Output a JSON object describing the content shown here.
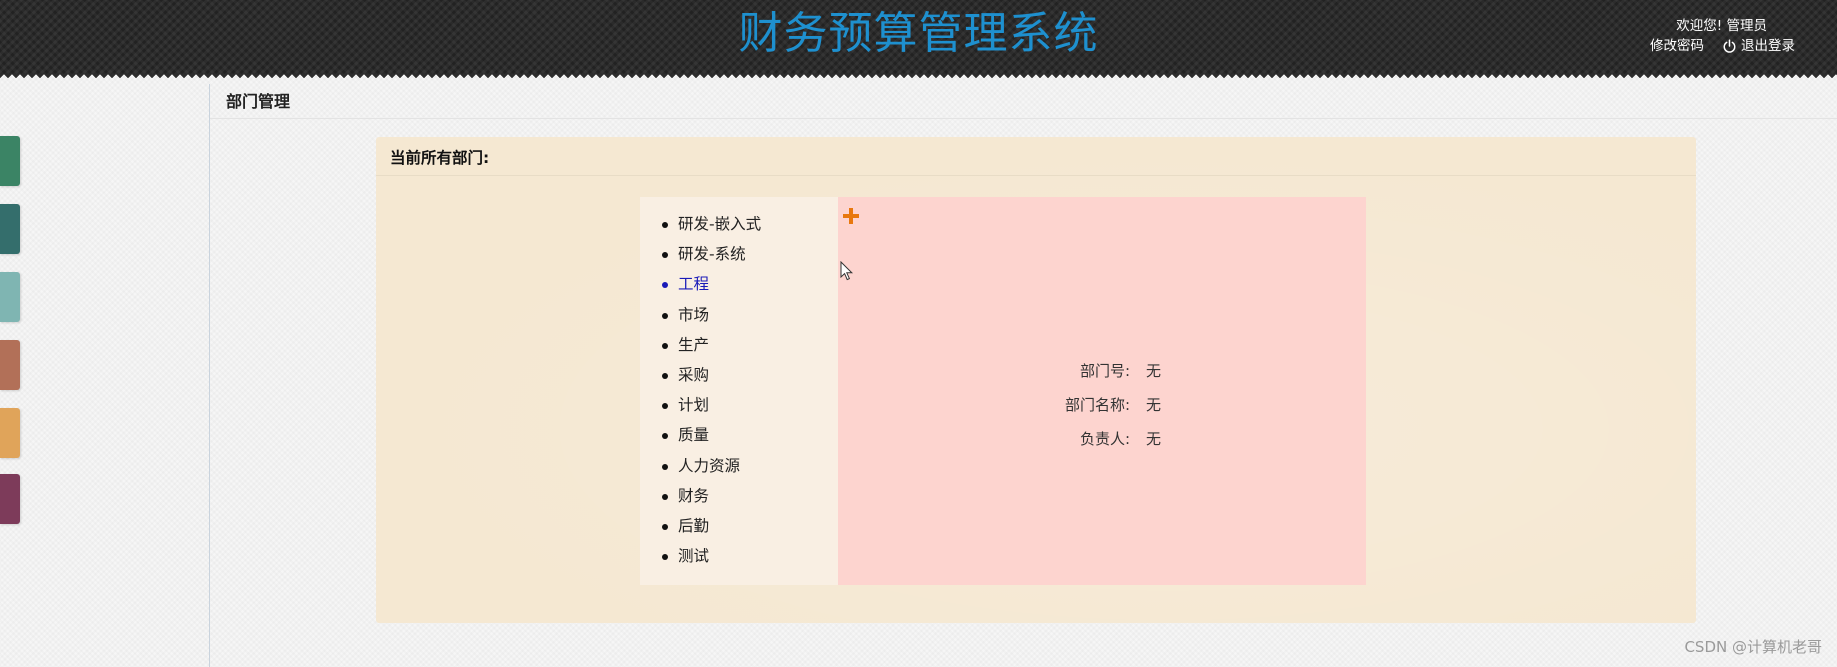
{
  "header": {
    "app_title": "财务预算管理系统",
    "welcome_text": "欢迎您!  管理员",
    "change_password": "修改密码",
    "logout": "退出登录"
  },
  "nav_tabs": [
    {
      "color": "#3b8465"
    },
    {
      "color": "#346e6c"
    },
    {
      "color": "#7fb5b2"
    },
    {
      "color": "#b27058"
    },
    {
      "color": "#e0a45a"
    },
    {
      "color": "#7d3b5a"
    }
  ],
  "page": {
    "title": "部门管理"
  },
  "panel": {
    "title": "当前所有部门:"
  },
  "departments": [
    {
      "name": "研发-嵌入式"
    },
    {
      "name": "研发-系统"
    },
    {
      "name": "工程",
      "active": true
    },
    {
      "name": "市场"
    },
    {
      "name": "生产"
    },
    {
      "name": "采购"
    },
    {
      "name": "计划"
    },
    {
      "name": "质量"
    },
    {
      "name": "人力资源"
    },
    {
      "name": "财务"
    },
    {
      "name": "后勤"
    },
    {
      "name": "测试"
    }
  ],
  "detail": {
    "dept_no_label": "部门号:",
    "dept_no_value": "无",
    "dept_name_label": "部门名称:",
    "dept_name_value": "无",
    "manager_label": "负责人:",
    "manager_value": "无"
  },
  "watermark": "CSDN @计算机老哥",
  "colors": {
    "accent_title": "#1e90cf",
    "add_icon": "#e8780e",
    "active_link": "#1a1ab8"
  }
}
